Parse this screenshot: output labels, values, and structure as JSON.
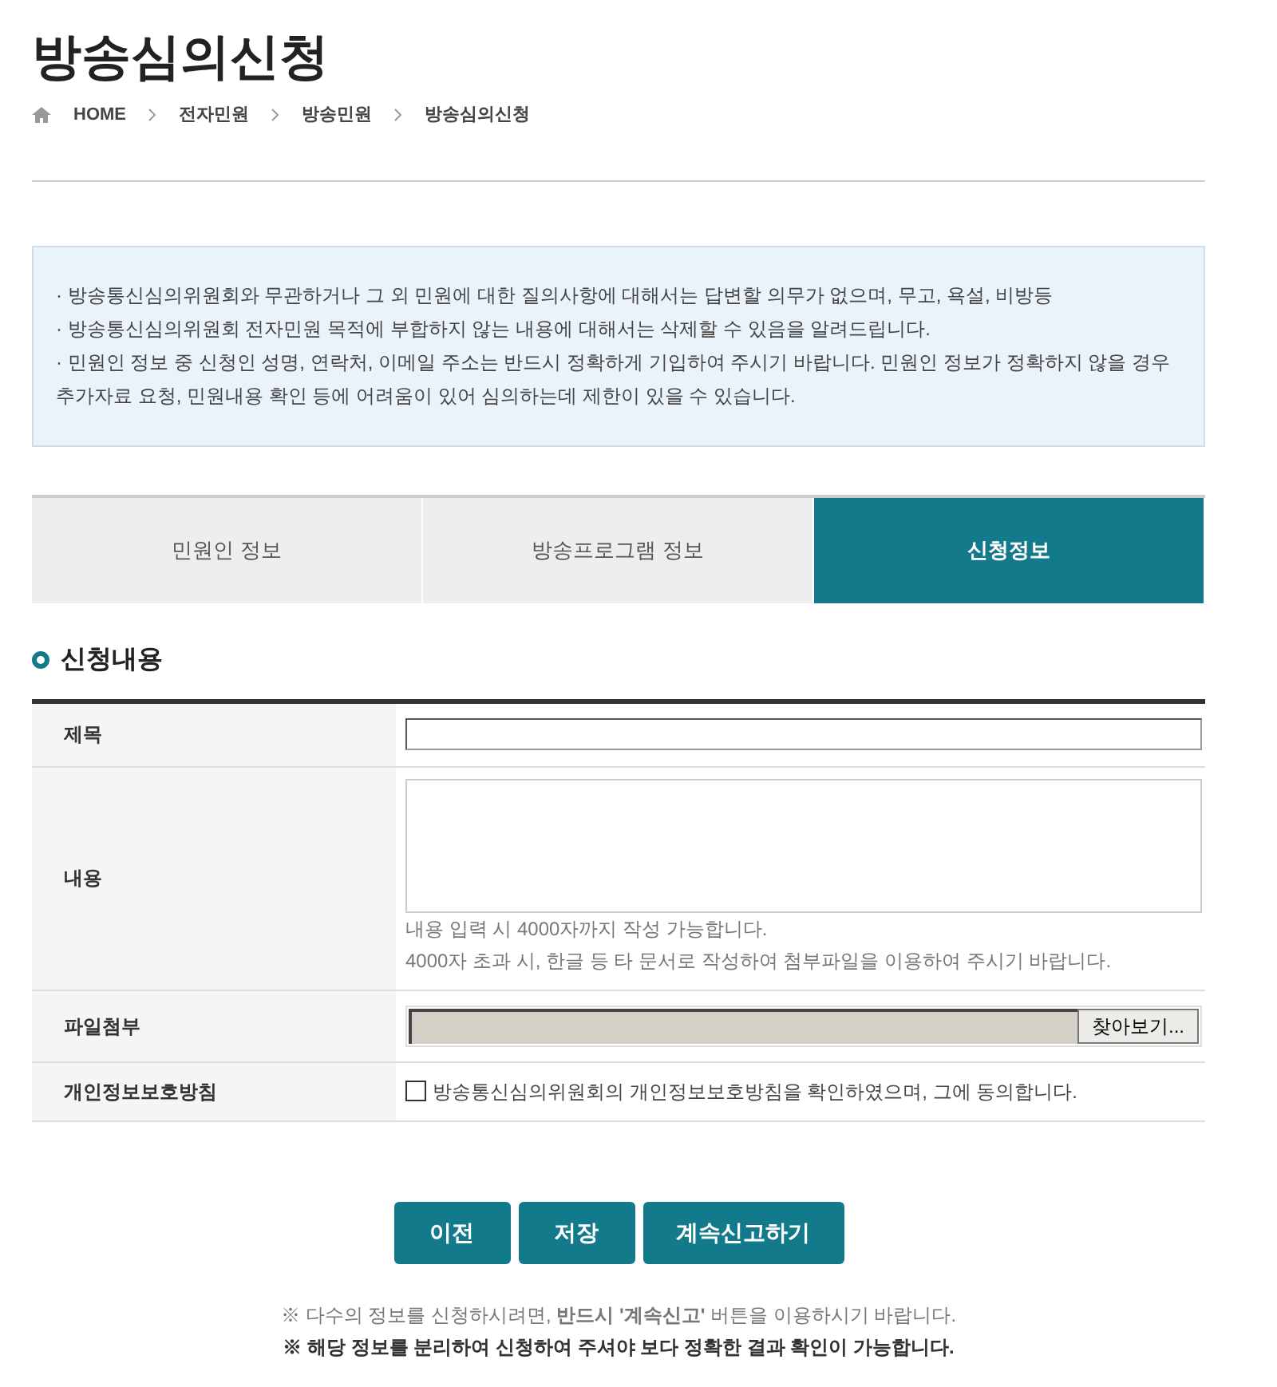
{
  "title": "방송심의신청",
  "breadcrumb": [
    "HOME",
    "전자민원",
    "방송민원",
    "방송심의신청"
  ],
  "notice": [
    "· 방송통신심의위원회와 무관하거나 그 외 민원에 대한 질의사항에 대해서는 답변할 의무가 없으며, 무고, 욕설, 비방등",
    "· 방송통신심의위원회 전자민원 목적에 부합하지 않는 내용에 대해서는 삭제할 수 있음을 알려드립니다.",
    "· 민원인 정보 중 신청인 성명, 연락처, 이메일 주소는 반드시 정확하게 기입하여 주시기 바랍니다. 민원인 정보가 정확하지 않을 경우 추가자료 요청, 민원내용 확인 등에 어려움이 있어 심의하는데 제한이 있을 수 있습니다."
  ],
  "tabs": [
    {
      "label": "민원인 정보",
      "selected": false
    },
    {
      "label": "방송프로그램 정보",
      "selected": false
    },
    {
      "label": "신청정보",
      "selected": true
    }
  ],
  "section_title": "신청내용",
  "form": [
    {
      "kind": "text",
      "label": "제목"
    },
    {
      "kind": "textarea",
      "label": "내용",
      "help": [
        "내용 입력 시 4000자까지 작성 가능합니다.",
        "4000자 초과 시, 한글 등 타 문서로 작성하여 첨부파일을 이용하여 주시기 바랍니다."
      ]
    },
    {
      "kind": "file",
      "label": "파일첨부",
      "button": "찾아보기..."
    },
    {
      "kind": "checkbox",
      "label": "개인정보보호방침",
      "text": "방송통신심의위원회의 개인정보보호방침을 확인하였으며, 그에 동의합니다.",
      "checked": false
    }
  ],
  "buttons": [
    "이전",
    "저장",
    "계속신고하기"
  ],
  "notes": [
    {
      "text": "※ 다수의 정보를 신청하시려면, **반드시 '계속신고'** 버튼을 이용하시기 바랍니다.",
      "bold": false
    },
    {
      "text": "※ 해당 정보를 분리하여 신청하여 주셔야 보다 정확한 결과 확인이 가능합니다.",
      "bold": true
    }
  ]
}
